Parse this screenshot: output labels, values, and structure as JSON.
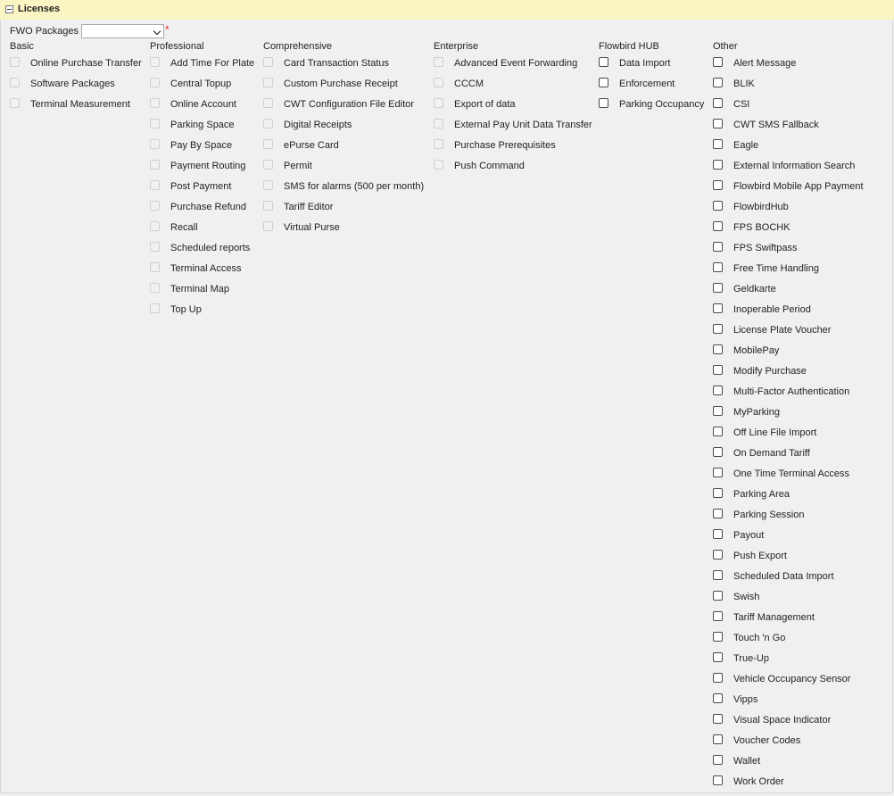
{
  "section": {
    "title": "Licenses"
  },
  "fwo": {
    "label": "FWO Packages",
    "selected": "",
    "required_mark": "*"
  },
  "columns": {
    "basic": {
      "title": "Basic",
      "items": [
        "Online Purchase Transfer",
        "Software Packages",
        "Terminal Measurement"
      ]
    },
    "professional": {
      "title": "Professional",
      "items": [
        "Add Time For Plate",
        "Central Topup",
        "Online Account",
        "Parking Space",
        "Pay By Space",
        "Payment Routing",
        "Post Payment",
        "Purchase Refund",
        "Recall",
        "Scheduled reports",
        "Terminal Access",
        "Terminal Map",
        "Top Up"
      ]
    },
    "comprehensive": {
      "title": "Comprehensive",
      "items": [
        "Card Transaction Status",
        "Custom Purchase Receipt",
        "CWT Configuration File Editor",
        "Digital Receipts",
        "ePurse Card",
        "Permit",
        "SMS for alarms (500 per month)",
        "Tariff Editor",
        "Virtual Purse"
      ]
    },
    "enterprise": {
      "title": "Enterprise",
      "items": [
        "Advanced Event Forwarding",
        "CCCM",
        "Export of data",
        "External Pay Unit Data Transfer",
        "Purchase Prerequisites",
        "Push Command"
      ]
    },
    "flowbird_hub": {
      "title": "Flowbird HUB",
      "items": [
        "Data Import",
        "Enforcement",
        "Parking Occupancy"
      ]
    },
    "other": {
      "title": "Other",
      "items": [
        "Alert Message",
        "BLIK",
        "CSI",
        "CWT SMS Fallback",
        "Eagle",
        "External Information Search",
        "Flowbird Mobile App Payment",
        "FlowbirdHub",
        "FPS BOCHK",
        "FPS Swiftpass",
        "Free Time Handling",
        "Geldkarte",
        "Inoperable Period",
        "License Plate Voucher",
        "MobilePay",
        "Modify Purchase",
        "Multi-Factor Authentication",
        "MyParking",
        "Off Line File Import",
        "On Demand Tariff",
        "One Time Terminal Access",
        "Parking Area",
        "Parking Session",
        "Payout",
        "Push Export",
        "Scheduled Data Import",
        "Swish",
        "Tariff Management",
        "Touch 'n Go",
        "True-Up",
        "Vehicle Occupancy Sensor",
        "Vipps",
        "Visual Space Indicator",
        "Voucher Codes",
        "Wallet",
        "Work Order"
      ]
    }
  }
}
